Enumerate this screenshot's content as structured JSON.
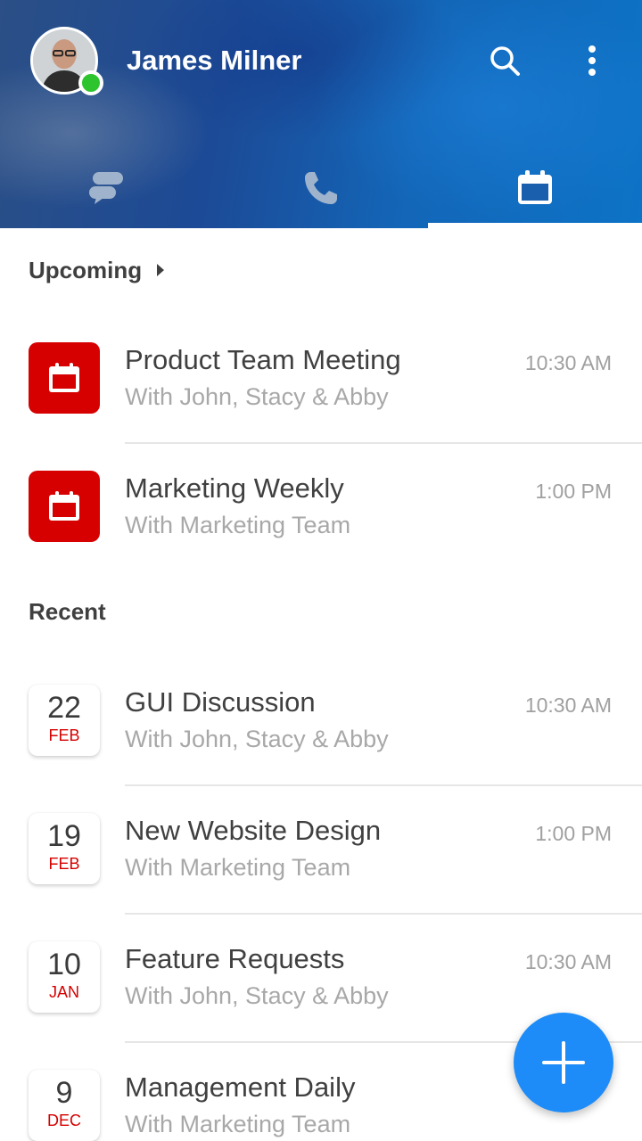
{
  "header": {
    "user_name": "James Milner",
    "presence_status": "online",
    "presence_color": "#2ec42e",
    "icons": {
      "search": "search-icon",
      "more": "more-vertical-icon"
    },
    "tabs": [
      {
        "name": "chats",
        "icon": "chat-bubbles-icon",
        "active": false
      },
      {
        "name": "calls",
        "icon": "phone-icon",
        "active": false
      },
      {
        "name": "calendar",
        "icon": "calendar-icon",
        "active": true
      }
    ]
  },
  "upcoming": {
    "title": "Upcoming",
    "items": [
      {
        "title": "Product Team Meeting",
        "subtitle": "With John, Stacy & Abby",
        "time": "10:30 AM"
      },
      {
        "title": "Marketing Weekly",
        "subtitle": "With Marketing Team",
        "time": "1:00 PM"
      }
    ]
  },
  "recent": {
    "title": "Recent",
    "items": [
      {
        "day": "22",
        "month": "FEB",
        "title": "GUI Discussion",
        "subtitle": "With John, Stacy & Abby",
        "time": "10:30 AM"
      },
      {
        "day": "19",
        "month": "FEB",
        "title": "New Website Design",
        "subtitle": "With Marketing Team",
        "time": "1:00 PM"
      },
      {
        "day": "10",
        "month": "JAN",
        "title": "Feature Requests",
        "subtitle": "With John, Stacy & Abby",
        "time": "10:30 AM"
      },
      {
        "day": "9",
        "month": "DEC",
        "title": "Management Daily",
        "subtitle": "With Marketing Team",
        "time": ""
      }
    ]
  },
  "colors": {
    "accent": "#1d8cf8",
    "calendar_red": "#d60000",
    "header_blue": "#1c4a96"
  },
  "fab": {
    "icon": "plus-icon"
  }
}
